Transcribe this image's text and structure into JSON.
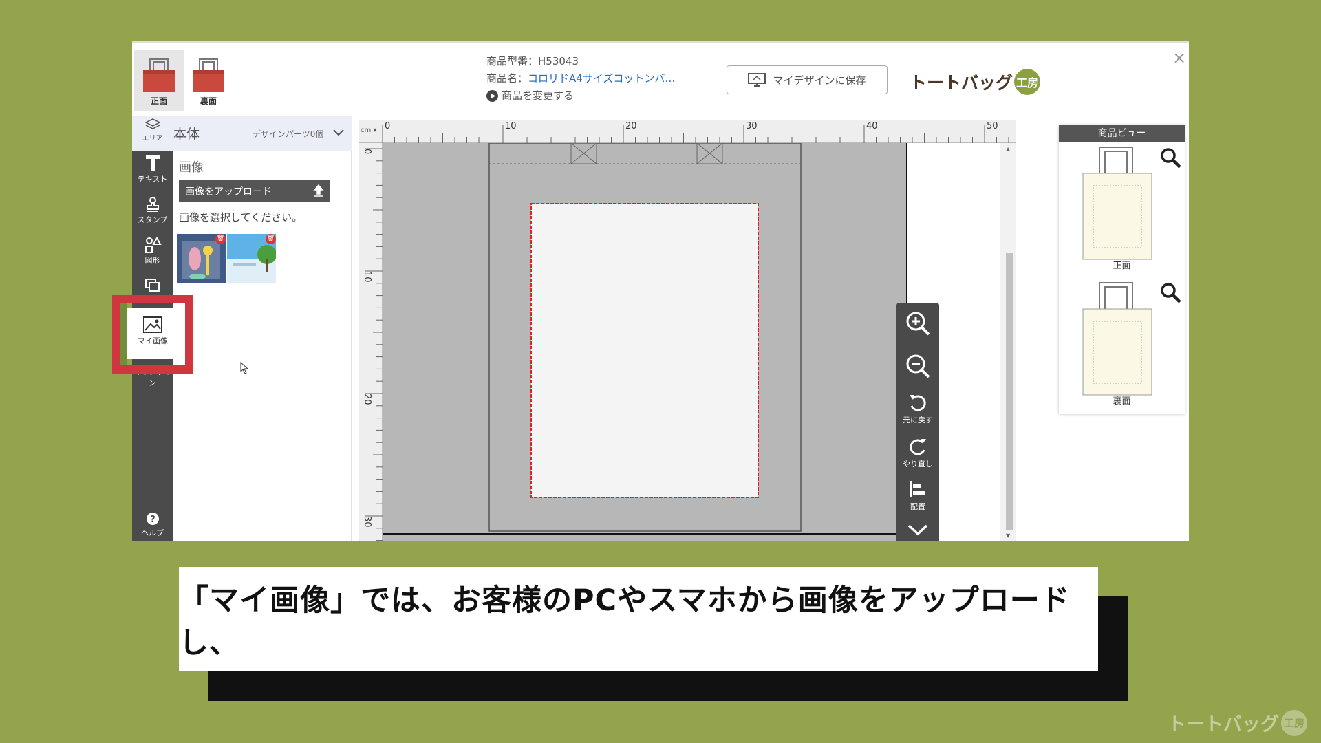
{
  "header": {
    "faces": [
      {
        "label": "正面"
      },
      {
        "label": "裏面"
      }
    ],
    "model_number": "商品型番：H53043",
    "product_name_prefix": "商品名：",
    "product_name_link": "コロリドA4サイズコットンバ…",
    "change_product": "商品を変更する",
    "save_button": "マイデザインに保存",
    "logo_text": "トートバッグ",
    "logo_badge": "工房"
  },
  "rail": {
    "area": "エリア",
    "items": [
      {
        "label": "テキスト",
        "icon": "text-icon"
      },
      {
        "label": "スタンプ",
        "icon": "stamp-icon"
      },
      {
        "label": "図形",
        "icon": "shapes-icon"
      },
      {
        "label": "",
        "icon": "layers-icon"
      },
      {
        "label": "マイ画像",
        "icon": "image-icon"
      },
      {
        "label": "マイデザイン",
        "icon": "design-icon"
      },
      {
        "label": "ヘルプ",
        "icon": "help-icon"
      }
    ]
  },
  "area_header": {
    "label": "本体",
    "parts": "デザインパーツ0個"
  },
  "panel": {
    "title": "画像",
    "upload_button": "画像をアップロード",
    "prompt": "画像を選択してください。"
  },
  "ruler": {
    "unit": "cm",
    "top_ticks": [
      "0",
      "10",
      "20",
      "30",
      "40",
      "50"
    ],
    "left_ticks": [
      "0",
      "10",
      "20",
      "30"
    ]
  },
  "tools": [
    {
      "label": "",
      "icon": "zoom-in-icon"
    },
    {
      "label": "",
      "icon": "zoom-out-icon"
    },
    {
      "label": "元に戻す",
      "icon": "undo-icon"
    },
    {
      "label": "やり直し",
      "icon": "redo-icon"
    },
    {
      "label": "配置",
      "icon": "align-icon"
    },
    {
      "label": "",
      "icon": "chevron-down-icon"
    }
  ],
  "product_view": {
    "title": "商品ビュー",
    "front": "正面",
    "back": "裏面"
  },
  "caption": "「マイ画像」では、お客様のPCやスマホから画像をアップロードし、",
  "watermark": {
    "text": "トートバッグ",
    "badge": "工房"
  },
  "colors": {
    "background": "#93a44d",
    "highlight": "#d0363f",
    "print_area_border": "#e02020"
  }
}
